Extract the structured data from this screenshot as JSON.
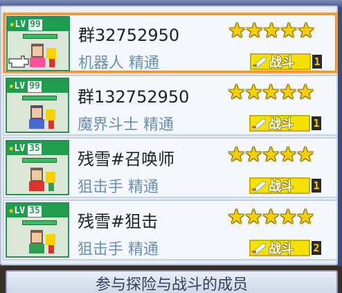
{
  "party_list": {
    "members": [
      {
        "name": "群32752950",
        "level": "99",
        "job_title": "机器人 精通",
        "stars": "★★★★★",
        "role_tag": "战斗",
        "role_num": "1",
        "selected": true,
        "hp_fraction": 1.0,
        "sprite_colors": [
          "#ff4f9a",
          "#ffd000"
        ]
      },
      {
        "name": "群132752950",
        "level": "99",
        "job_title": "魔界斗士 精通",
        "stars": "★★★★★",
        "role_tag": "战斗",
        "role_num": "1",
        "selected": false,
        "hp_fraction": 1.0,
        "sprite_colors": [
          "#4a6ad0",
          "#ffd000"
        ]
      },
      {
        "name": "残雪#召唤师",
        "level": "35",
        "job_title": "狙击手 精通",
        "stars": "★★★★★",
        "role_tag": "战斗",
        "role_num": "1",
        "selected": false,
        "hp_fraction": 1.0,
        "sprite_colors": [
          "#e03030",
          "#ffd000"
        ]
      },
      {
        "name": "残雪#狙击",
        "level": "35",
        "job_title": "狙击手 精通",
        "stars": "★★★★★",
        "role_tag": "战斗",
        "role_num": "2",
        "selected": false,
        "hp_fraction": 1.0,
        "sprite_colors": [
          "#30a050",
          "#ffd000"
        ]
      }
    ]
  },
  "level_icon": "star-icon",
  "level_prefix": "LV",
  "footer": {
    "label": "参与探险与战斗的成员"
  },
  "colors": {
    "selected_border": "#f0a040",
    "level_badge": "#1f9d4e",
    "stars": "#f5d000",
    "job_text": "#6a8fb0",
    "tag_bg": "#f5e000"
  }
}
